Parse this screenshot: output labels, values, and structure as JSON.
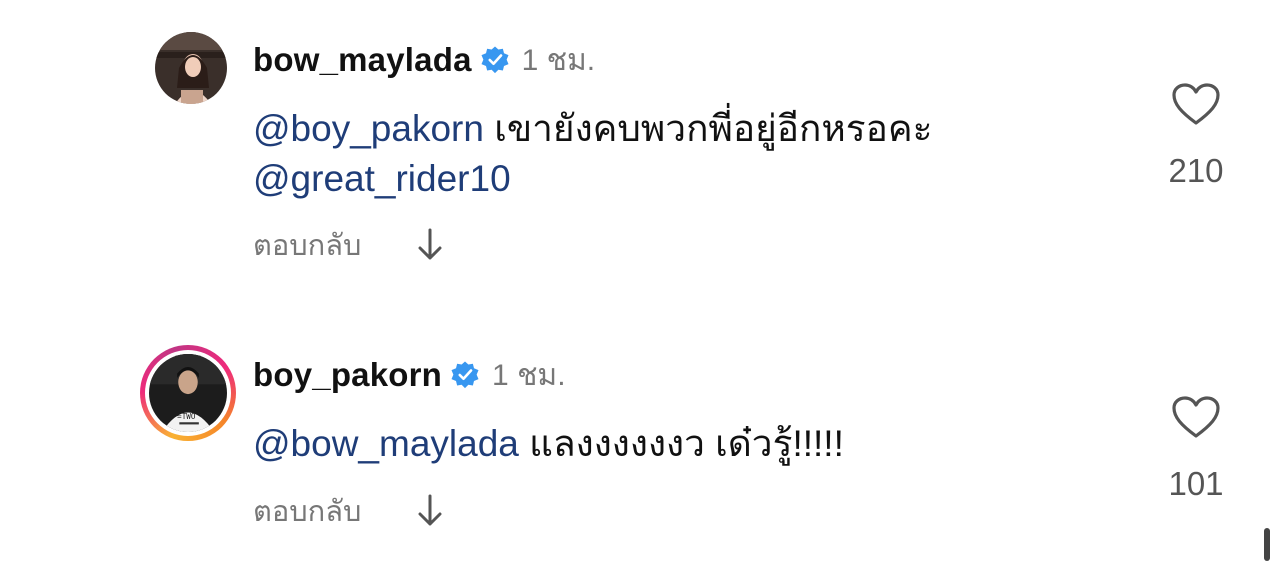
{
  "comments": [
    {
      "username": "bow_maylada",
      "time": "1 ชม.",
      "mention1": "@boy_pakorn",
      "text": " เขายังคบพวกพี่อยู่อีกหรอคะ ",
      "mention2": "@great_rider10",
      "reply_label": "ตอบกลับ",
      "likes": "210"
    },
    {
      "username": "boy_pakorn",
      "time": "1 ชม.",
      "mention1": "@bow_maylada",
      "text": " แลงงงงงงว เด๋วรู้!!!!!",
      "reply_label": "ตอบกลับ",
      "likes": "101"
    }
  ],
  "colors": {
    "mention": "#1f3d78",
    "verified": "#3897f0",
    "muted": "#777777"
  },
  "icons": [
    "verified-badge-icon",
    "arrow-down-icon",
    "heart-icon"
  ]
}
